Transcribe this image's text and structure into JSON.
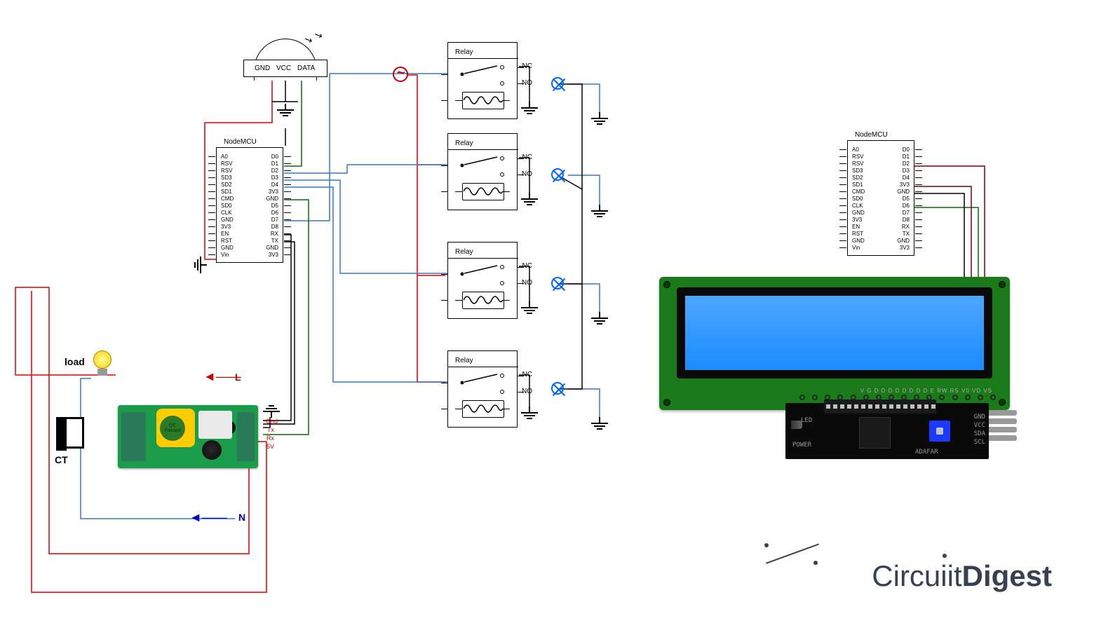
{
  "watermark": {
    "circuit": "Circu",
    "it": "it",
    "digest": "Digest"
  },
  "sensor": {
    "pin1": "GND",
    "pin2": "VCC",
    "pin3": "DATA"
  },
  "nodemcu1": {
    "title": "NodeMCU",
    "left_pins": [
      "A0",
      "RSV",
      "RSV",
      "SD3",
      "SD2",
      "SD1",
      "CMD",
      "SD0",
      "CLK",
      "GND",
      "3V3",
      "EN",
      "RST",
      "GND",
      "Vin"
    ],
    "right_pins": [
      "D0",
      "D1",
      "D2",
      "D3",
      "D4",
      "3V3",
      "GND",
      "D5",
      "D6",
      "D7",
      "D8",
      "RX",
      "TX",
      "GND",
      "3V3"
    ]
  },
  "nodemcu2": {
    "title": "NodeMCU",
    "left_pins": [
      "A0",
      "RSV",
      "RSV",
      "SD3",
      "SD2",
      "SD1",
      "CMD",
      "SD0",
      "CLK",
      "GND",
      "3V3",
      "EN",
      "RST",
      "GND",
      "Vin"
    ],
    "right_pins": [
      "D0",
      "D1",
      "D2",
      "D3",
      "D4",
      "3V3",
      "GND",
      "D5",
      "D6",
      "D7",
      "D8",
      "RX",
      "TX",
      "GND",
      "3V3"
    ]
  },
  "relay": {
    "title": "Relay",
    "nc": "NC",
    "no": "NO"
  },
  "pzem": {
    "load": "load",
    "l": "L",
    "n": "N",
    "ct": "CT",
    "pins": [
      "Gnd",
      "Tx",
      "Rx",
      "5V"
    ]
  },
  "i2c": {
    "pins": [
      "GND",
      "VCC",
      "SDA",
      "SCL"
    ],
    "led": "LED",
    "pwr": "POWER",
    "brand": "ADAFAR"
  },
  "lcd_header_pins": "V G D D D D D D D D   E  RW RS V0 VD VS"
}
